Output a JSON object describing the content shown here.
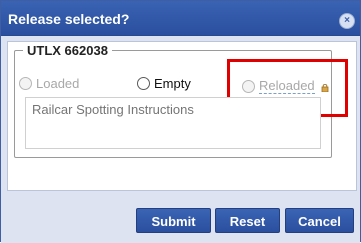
{
  "dialog": {
    "title": "Release selected?",
    "close_label": "×"
  },
  "group": {
    "legend": "UTLX 662038",
    "options": [
      {
        "label": "Loaded",
        "state": "disabled"
      },
      {
        "label": "Empty",
        "state": "enabled"
      },
      {
        "label": "Reloaded",
        "state": "disabled",
        "icon": "lock-icon"
      }
    ]
  },
  "instructions": {
    "placeholder": "Railcar Spotting Instructions"
  },
  "buttons": {
    "submit": "Submit",
    "reset": "Reset",
    "cancel": "Cancel"
  },
  "colors": {
    "accent": "#2f56a6",
    "highlight": "#e00000"
  }
}
